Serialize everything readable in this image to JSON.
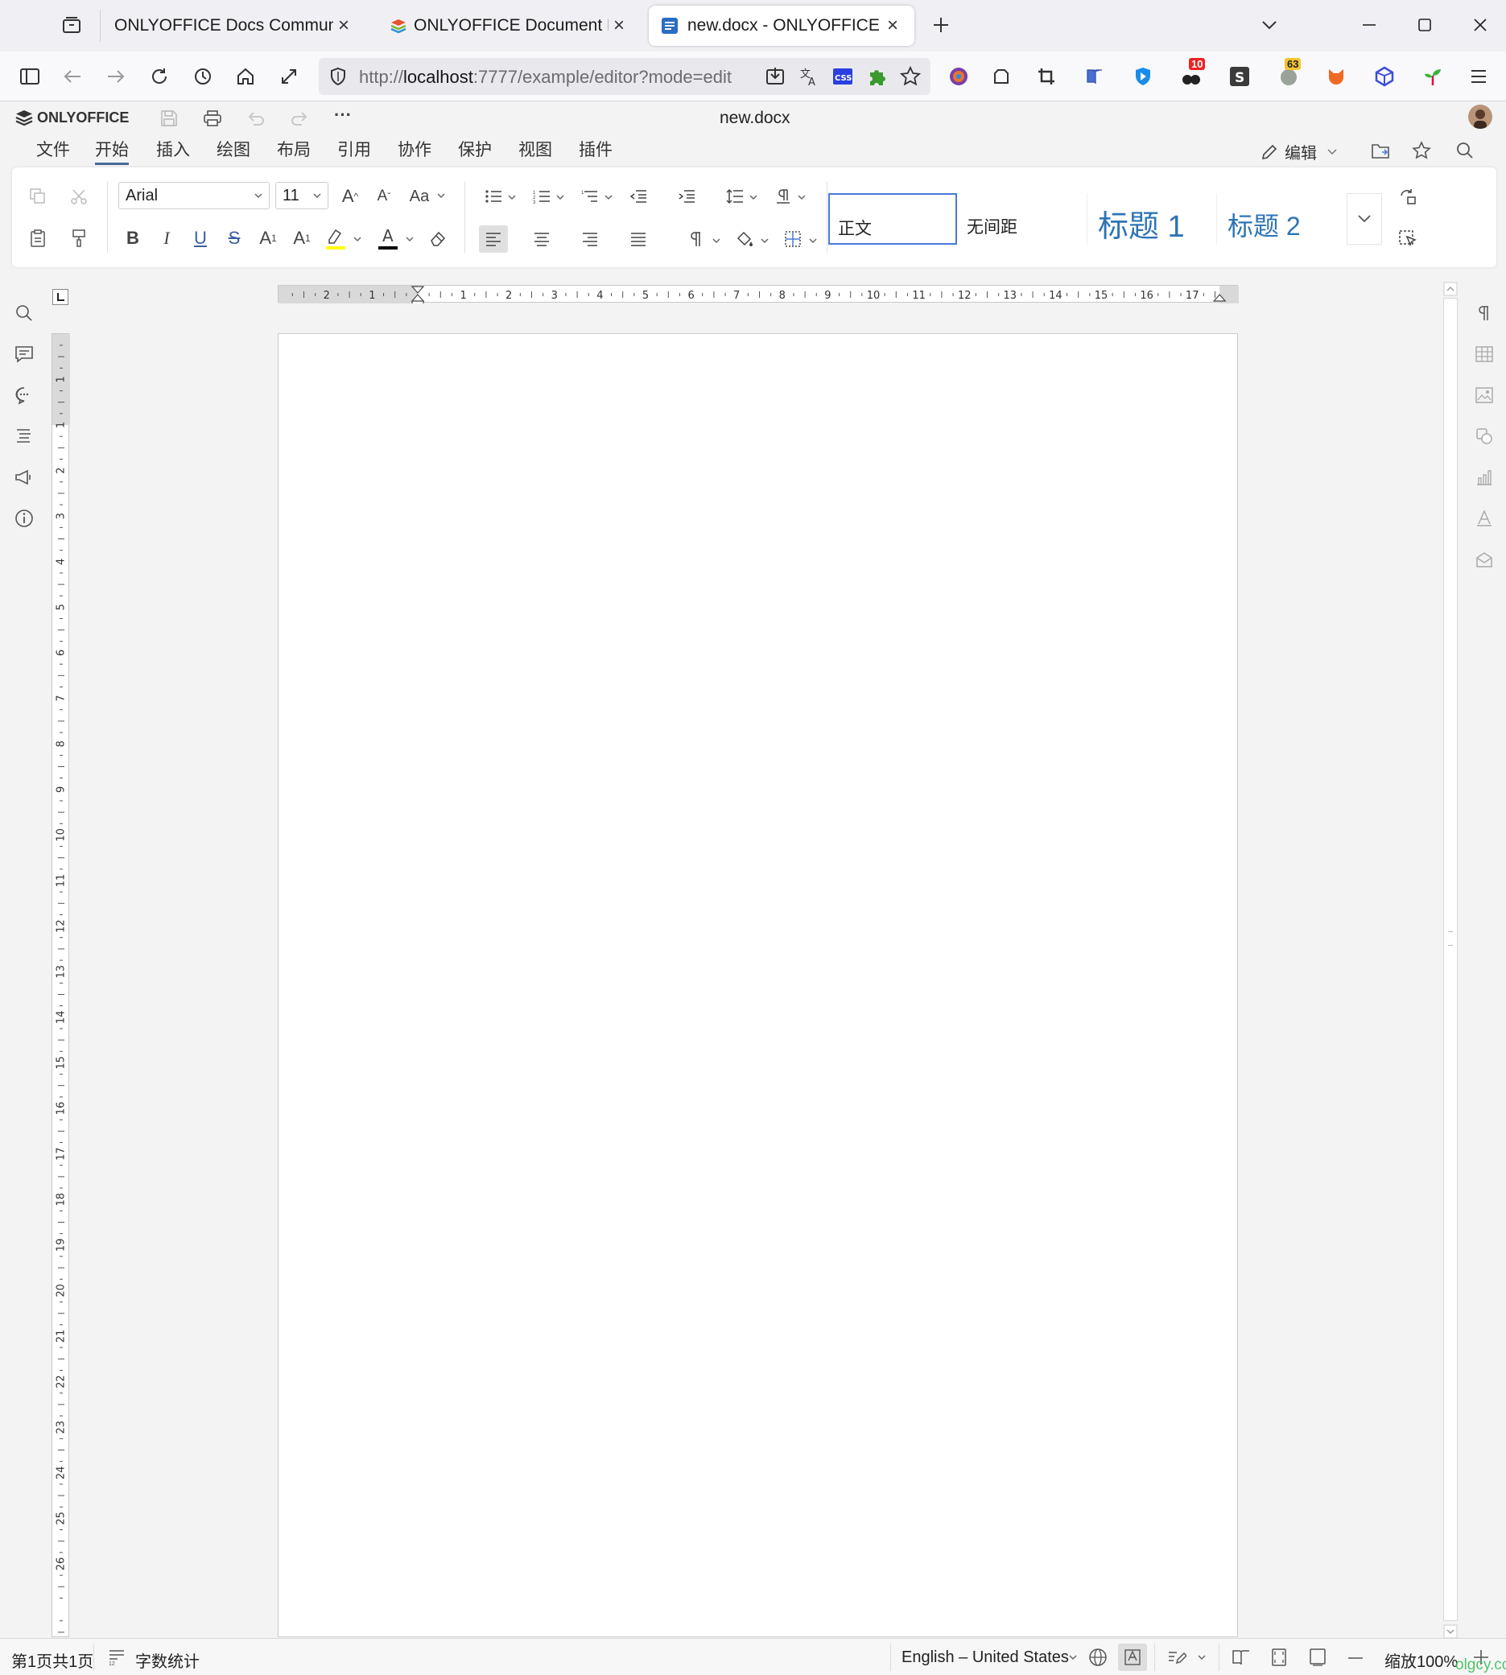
{
  "browser": {
    "tabs": [
      {
        "title": "ONLYOFFICE Docs Community Ed",
        "active": false
      },
      {
        "title": "ONLYOFFICE Document Edito",
        "active": false
      },
      {
        "title": "new.docx - ONLYOFFICE",
        "active": true
      }
    ],
    "url_host": "localhost",
    "url_prefix": "http://",
    "url_rest": ":7777/example/editor?mode=edit",
    "badges": {
      "ext_a": "10",
      "ext_b": "63"
    }
  },
  "app": {
    "logo_text": "ONLYOFFICE",
    "doc_title": "new.docx",
    "menu_tabs": [
      "文件",
      "开始",
      "插入",
      "绘图",
      "布局",
      "引用",
      "协作",
      "保护",
      "视图",
      "插件"
    ],
    "active_menu": "开始",
    "edit_mode_label": "编辑"
  },
  "toolbar": {
    "font_name": "Arial",
    "font_size": "11",
    "change_case": "Aa",
    "styles": [
      {
        "label": "正文",
        "selected": true
      },
      {
        "label": "无间距",
        "selected": false
      },
      {
        "label": "标题 1",
        "selected": false
      },
      {
        "label": "标题 2",
        "selected": false
      }
    ],
    "highlight_color": "#ffff00",
    "font_color": "#000000",
    "heading_color": "#2e74b5"
  },
  "ruler": {
    "h_left_labels": [
      "2",
      "1"
    ],
    "h_right_labels": [
      "1",
      "2",
      "3",
      "4",
      "5",
      "6",
      "7",
      "8",
      "9",
      "10",
      "11",
      "12",
      "13",
      "14",
      "15",
      "16",
      "17"
    ],
    "v_labels": [
      "1",
      "1",
      "2",
      "3",
      "4",
      "5",
      "6",
      "7",
      "8",
      "9",
      "10",
      "11",
      "12",
      "13",
      "14",
      "15",
      "16",
      "17",
      "18",
      "19",
      "20",
      "21",
      "22",
      "23",
      "24",
      "25",
      "26"
    ]
  },
  "status": {
    "page_info": "第1页共1页",
    "word_count": "字数统计",
    "language": "English – United States",
    "zoom": "缩放100%",
    "watermark": "olgcy.com"
  },
  "colors": {
    "accent": "#446995",
    "logo": "#333333"
  }
}
